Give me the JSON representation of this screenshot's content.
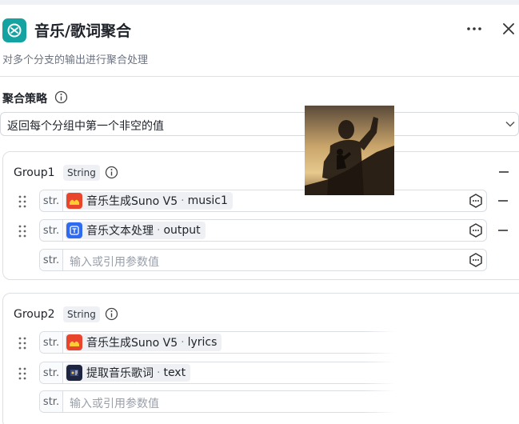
{
  "header": {
    "title": "音乐/歌词聚合",
    "subtitle": "对多个分支的输出进行聚合处理",
    "more_icon": "more-horizontal-icon",
    "close_icon": "close-icon"
  },
  "strategy": {
    "label": "聚合策略",
    "value": "返回每个分组中第一个非空的值"
  },
  "placeholder": "输入或引用参数值",
  "groups": [
    {
      "name": "Group1",
      "type": "String",
      "items": [
        {
          "prefix": "str.",
          "node": "音乐生成Suno V5",
          "sep": "·",
          "var": "music1",
          "icon": "suno-icon"
        },
        {
          "prefix": "str.",
          "node": "音乐文本处理",
          "sep": "·",
          "var": "output",
          "icon": "text-process-icon"
        },
        {
          "prefix": "str.",
          "empty": true
        }
      ]
    },
    {
      "name": "Group2",
      "type": "String",
      "items": [
        {
          "prefix": "str.",
          "node": "音乐生成Suno V5",
          "sep": "·",
          "var": "lyrics",
          "icon": "suno-icon"
        },
        {
          "prefix": "str.",
          "node": "提取音乐歌词",
          "sep": "·",
          "var": "text",
          "icon": "lyrics-extract-icon"
        },
        {
          "prefix": "str.",
          "empty": true
        }
      ]
    }
  ],
  "colors": {
    "accent": "#14a3a1",
    "suno": "#e8452c",
    "text_process": "#2f6bf0",
    "lyrics_extract": "#1d2540"
  }
}
